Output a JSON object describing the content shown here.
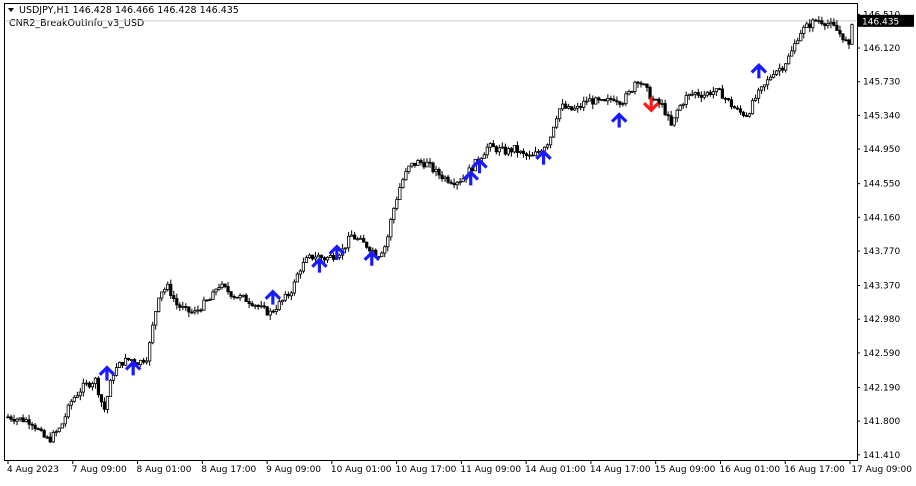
{
  "header": {
    "symbol_line": "USDJPY,H1  146.428 146.466 146.428 146.435",
    "indicator_name": "CNR2_BreakOutInfo_v3_USD"
  },
  "colors": {
    "background": "#ffffff",
    "candle": "#000000",
    "up_arrow": "#1a1aff",
    "down_arrow": "#ff1a1a",
    "price_tag_bg": "#000000",
    "price_tag_text": "#ffffff",
    "current_price_line": "#c8c8c8"
  },
  "chart_data": {
    "type": "candlestick",
    "symbol": "USDJPY",
    "timeframe": "H1",
    "ohlc_last": {
      "open": 146.428,
      "high": 146.466,
      "low": 146.428,
      "close": 146.435
    },
    "current_price": 146.435,
    "current_price_label": "146.435",
    "ylim": [
      141.35,
      146.63
    ],
    "y_ticks": [
      "146.510",
      "146.120",
      "145.730",
      "145.340",
      "144.950",
      "144.550",
      "144.160",
      "143.770",
      "143.370",
      "142.980",
      "142.590",
      "142.190",
      "141.800",
      "141.410"
    ],
    "x_ticks": [
      "4 Aug 2023",
      "7 Aug 09:00",
      "8 Aug 01:00",
      "8 Aug 17:00",
      "9 Aug 09:00",
      "10 Aug 01:00",
      "10 Aug 17:00",
      "11 Aug 09:00",
      "14 Aug 01:00",
      "14 Aug 17:00",
      "15 Aug 09:00",
      "16 Aug 01:00",
      "16 Aug 17:00",
      "17 Aug 09:00"
    ],
    "bars": [
      {
        "t": 0,
        "c": 141.85
      },
      {
        "t": 8,
        "c": 141.8
      },
      {
        "t": 12,
        "c": 141.62
      },
      {
        "t": 14,
        "c": 141.58
      },
      {
        "t": 18,
        "c": 141.72
      },
      {
        "t": 22,
        "c": 142.05
      },
      {
        "t": 26,
        "c": 142.2
      },
      {
        "t": 30,
        "c": 142.28
      },
      {
        "t": 33,
        "c": 141.92
      },
      {
        "t": 36,
        "c": 142.35
      },
      {
        "t": 39,
        "c": 142.48
      },
      {
        "t": 42,
        "c": 142.52
      },
      {
        "t": 45,
        "c": 142.48
      },
      {
        "t": 48,
        "c": 142.55
      },
      {
        "t": 50,
        "c": 142.95
      },
      {
        "t": 52,
        "c": 143.3
      },
      {
        "t": 55,
        "c": 143.35
      },
      {
        "t": 58,
        "c": 143.15
      },
      {
        "t": 61,
        "c": 143.08
      },
      {
        "t": 64,
        "c": 143.05
      },
      {
        "t": 67,
        "c": 143.15
      },
      {
        "t": 70,
        "c": 143.22
      },
      {
        "t": 72,
        "c": 143.38
      },
      {
        "t": 75,
        "c": 143.32
      },
      {
        "t": 78,
        "c": 143.25
      },
      {
        "t": 81,
        "c": 143.22
      },
      {
        "t": 84,
        "c": 143.18
      },
      {
        "t": 87,
        "c": 143.1
      },
      {
        "t": 90,
        "c": 143.05
      },
      {
        "t": 93,
        "c": 143.15
      },
      {
        "t": 96,
        "c": 143.25
      },
      {
        "t": 98,
        "c": 143.35
      },
      {
        "t": 100,
        "c": 143.55
      },
      {
        "t": 103,
        "c": 143.68
      },
      {
        "t": 106,
        "c": 143.72
      },
      {
        "t": 109,
        "c": 143.68
      },
      {
        "t": 112,
        "c": 143.72
      },
      {
        "t": 115,
        "c": 143.78
      },
      {
        "t": 118,
        "c": 143.95
      },
      {
        "t": 121,
        "c": 143.88
      },
      {
        "t": 124,
        "c": 143.82
      },
      {
        "t": 127,
        "c": 143.72
      },
      {
        "t": 130,
        "c": 143.85
      },
      {
        "t": 132,
        "c": 144.2
      },
      {
        "t": 135,
        "c": 144.55
      },
      {
        "t": 138,
        "c": 144.75
      },
      {
        "t": 141,
        "c": 144.8
      },
      {
        "t": 144,
        "c": 144.78
      },
      {
        "t": 147,
        "c": 144.68
      },
      {
        "t": 150,
        "c": 144.62
      },
      {
        "t": 153,
        "c": 144.58
      },
      {
        "t": 156,
        "c": 144.6
      },
      {
        "t": 159,
        "c": 144.72
      },
      {
        "t": 162,
        "c": 144.85
      },
      {
        "t": 165,
        "c": 144.98
      },
      {
        "t": 168,
        "c": 144.95
      },
      {
        "t": 171,
        "c": 144.92
      },
      {
        "t": 174,
        "c": 144.95
      },
      {
        "t": 177,
        "c": 144.88
      },
      {
        "t": 180,
        "c": 144.85
      },
      {
        "t": 183,
        "c": 144.95
      },
      {
        "t": 186,
        "c": 145.05
      },
      {
        "t": 188,
        "c": 145.3
      },
      {
        "t": 190,
        "c": 145.45
      },
      {
        "t": 193,
        "c": 145.4
      },
      {
        "t": 196,
        "c": 145.42
      },
      {
        "t": 199,
        "c": 145.52
      },
      {
        "t": 202,
        "c": 145.5
      },
      {
        "t": 205,
        "c": 145.48
      },
      {
        "t": 208,
        "c": 145.55
      },
      {
        "t": 211,
        "c": 145.5
      },
      {
        "t": 214,
        "c": 145.62
      },
      {
        "t": 216,
        "c": 145.78
      },
      {
        "t": 219,
        "c": 145.65
      },
      {
        "t": 222,
        "c": 145.5
      },
      {
        "t": 225,
        "c": 145.45
      },
      {
        "t": 228,
        "c": 145.2
      },
      {
        "t": 230,
        "c": 145.4
      },
      {
        "t": 233,
        "c": 145.55
      },
      {
        "t": 236,
        "c": 145.6
      },
      {
        "t": 239,
        "c": 145.58
      },
      {
        "t": 242,
        "c": 145.62
      },
      {
        "t": 245,
        "c": 145.6
      },
      {
        "t": 248,
        "c": 145.48
      },
      {
        "t": 251,
        "c": 145.38
      },
      {
        "t": 254,
        "c": 145.35
      },
      {
        "t": 257,
        "c": 145.55
      },
      {
        "t": 260,
        "c": 145.68
      },
      {
        "t": 263,
        "c": 145.85
      },
      {
        "t": 266,
        "c": 145.9
      },
      {
        "t": 269,
        "c": 146.05
      },
      {
        "t": 272,
        "c": 146.3
      },
      {
        "t": 275,
        "c": 146.38
      },
      {
        "t": 278,
        "c": 146.45
      },
      {
        "t": 281,
        "c": 146.42
      },
      {
        "t": 284,
        "c": 146.35
      },
      {
        "t": 287,
        "c": 146.25
      },
      {
        "t": 289,
        "c": 146.12
      },
      {
        "t": 290,
        "c": 146.43
      }
    ],
    "signals": [
      {
        "t": 34,
        "dir": "up",
        "price": 142.42
      },
      {
        "t": 43,
        "dir": "up",
        "price": 142.48
      },
      {
        "t": 91,
        "dir": "up",
        "price": 143.3
      },
      {
        "t": 107,
        "dir": "up",
        "price": 143.67
      },
      {
        "t": 113,
        "dir": "up",
        "price": 143.82
      },
      {
        "t": 125,
        "dir": "up",
        "price": 143.75
      },
      {
        "t": 159,
        "dir": "up",
        "price": 144.68
      },
      {
        "t": 162,
        "dir": "up",
        "price": 144.82
      },
      {
        "t": 184,
        "dir": "up",
        "price": 144.92
      },
      {
        "t": 210,
        "dir": "up",
        "price": 145.35
      },
      {
        "t": 221,
        "dir": "down",
        "price": 145.4
      },
      {
        "t": 258,
        "dir": "up",
        "price": 145.92
      }
    ]
  }
}
